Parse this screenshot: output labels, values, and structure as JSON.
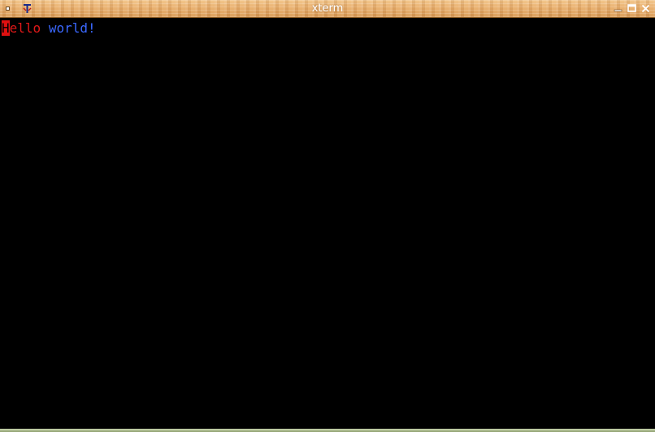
{
  "window": {
    "title": "xterm"
  },
  "icons": {
    "menu": "window-menu-icon",
    "app": "xterm-app-icon",
    "minimize": "minimize-icon",
    "maximize": "maximize-icon",
    "close": "close-icon"
  },
  "terminal": {
    "line1": {
      "cursor_char": "H",
      "red_text": "ello",
      "space": " ",
      "blue_text": "world!"
    }
  },
  "colors": {
    "background": "#000000",
    "red_text": "#e01818",
    "blue_text": "#3b68ff",
    "cursor": "#e01010",
    "titlebar": "#e8ad6a"
  }
}
